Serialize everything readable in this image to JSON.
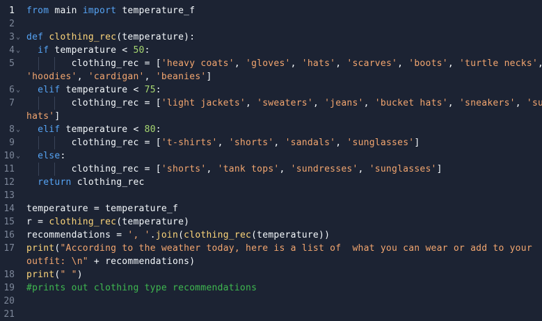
{
  "editor": {
    "lines": [
      {
        "n": "1",
        "active": true,
        "fold": false,
        "tokens": [
          [
            "kw",
            "from"
          ],
          [
            "op",
            " main "
          ],
          [
            "kw",
            "import"
          ],
          [
            "op",
            " temperature_f"
          ]
        ]
      },
      {
        "n": "2",
        "fold": false,
        "tokens": []
      },
      {
        "n": "3",
        "fold": true,
        "tokens": [
          [
            "kw",
            "def"
          ],
          [
            "op",
            " "
          ],
          [
            "fn",
            "clothing_rec"
          ],
          [
            "op",
            "(temperature):"
          ]
        ]
      },
      {
        "n": "4",
        "fold": true,
        "tokens": [
          [
            "op",
            "  "
          ],
          [
            "kw",
            "if"
          ],
          [
            "op",
            " temperature < "
          ],
          [
            "num",
            "50"
          ],
          [
            "op",
            ":"
          ]
        ]
      },
      {
        "n": "5",
        "fold": false,
        "guides": [
          2
        ],
        "tokens": [
          [
            "op",
            "        clothing_rec = ["
          ],
          [
            "str",
            "'heavy coats'"
          ],
          [
            "op",
            ", "
          ],
          [
            "str",
            "'gloves'"
          ],
          [
            "op",
            ", "
          ],
          [
            "str",
            "'hats'"
          ],
          [
            "op",
            ", "
          ],
          [
            "str",
            "'scarves'"
          ],
          [
            "op",
            ", "
          ],
          [
            "str",
            "'boots'"
          ],
          [
            "op",
            ", "
          ],
          [
            "str",
            "'turtle necks'"
          ],
          [
            "op",
            ","
          ]
        ]
      },
      {
        "n": "",
        "fold": false,
        "tokens": [
          [
            "str",
            "'hoodies'"
          ],
          [
            "op",
            ", "
          ],
          [
            "str",
            "'cardigan'"
          ],
          [
            "op",
            ", "
          ],
          [
            "str",
            "'beanies'"
          ],
          [
            "op",
            "]"
          ]
        ]
      },
      {
        "n": "6",
        "fold": true,
        "tokens": [
          [
            "op",
            "  "
          ],
          [
            "kw",
            "elif"
          ],
          [
            "op",
            " temperature < "
          ],
          [
            "num",
            "75"
          ],
          [
            "op",
            ":"
          ]
        ]
      },
      {
        "n": "7",
        "fold": false,
        "guides": [
          2
        ],
        "tokens": [
          [
            "op",
            "        clothing_rec = ["
          ],
          [
            "str",
            "'light jackets'"
          ],
          [
            "op",
            ", "
          ],
          [
            "str",
            "'sweaters'"
          ],
          [
            "op",
            ", "
          ],
          [
            "str",
            "'jeans'"
          ],
          [
            "op",
            ", "
          ],
          [
            "str",
            "'bucket hats'"
          ],
          [
            "op",
            ", "
          ],
          [
            "str",
            "'sneakers'"
          ],
          [
            "op",
            ", "
          ],
          [
            "str",
            "'sun"
          ]
        ]
      },
      {
        "n": "",
        "fold": false,
        "tokens": [
          [
            "str",
            "hats'"
          ],
          [
            "op",
            "]"
          ]
        ]
      },
      {
        "n": "8",
        "fold": true,
        "tokens": [
          [
            "op",
            "  "
          ],
          [
            "kw",
            "elif"
          ],
          [
            "op",
            " temperature < "
          ],
          [
            "num",
            "80"
          ],
          [
            "op",
            ":"
          ]
        ]
      },
      {
        "n": "9",
        "fold": false,
        "guides": [
          2
        ],
        "tokens": [
          [
            "op",
            "        clothing_rec = ["
          ],
          [
            "str",
            "'t-shirts'"
          ],
          [
            "op",
            ", "
          ],
          [
            "str",
            "'shorts'"
          ],
          [
            "op",
            ", "
          ],
          [
            "str",
            "'sandals'"
          ],
          [
            "op",
            ", "
          ],
          [
            "str",
            "'sunglasses'"
          ],
          [
            "op",
            "]"
          ]
        ]
      },
      {
        "n": "10",
        "fold": true,
        "tokens": [
          [
            "op",
            "  "
          ],
          [
            "kw",
            "else"
          ],
          [
            "op",
            ":"
          ]
        ]
      },
      {
        "n": "11",
        "fold": false,
        "guides": [
          2
        ],
        "tokens": [
          [
            "op",
            "        clothing_rec = ["
          ],
          [
            "str",
            "'shorts'"
          ],
          [
            "op",
            ", "
          ],
          [
            "str",
            "'tank tops'"
          ],
          [
            "op",
            ", "
          ],
          [
            "str",
            "'sundresses'"
          ],
          [
            "op",
            ", "
          ],
          [
            "str",
            "'sunglasses'"
          ],
          [
            "op",
            "]"
          ]
        ]
      },
      {
        "n": "12",
        "fold": false,
        "tokens": [
          [
            "op",
            "  "
          ],
          [
            "kw",
            "return"
          ],
          [
            "op",
            " clothing_rec"
          ]
        ]
      },
      {
        "n": "13",
        "fold": false,
        "tokens": []
      },
      {
        "n": "14",
        "fold": false,
        "tokens": [
          [
            "op",
            "temperature = temperature_f"
          ]
        ]
      },
      {
        "n": "15",
        "fold": false,
        "tokens": [
          [
            "op",
            "r = "
          ],
          [
            "fn",
            "clothing_rec"
          ],
          [
            "op",
            "(temperature)"
          ]
        ]
      },
      {
        "n": "16",
        "fold": false,
        "tokens": [
          [
            "op",
            "recommendations = "
          ],
          [
            "str",
            "', '"
          ],
          [
            "op",
            "."
          ],
          [
            "fn",
            "join"
          ],
          [
            "op",
            "("
          ],
          [
            "fn",
            "clothing_rec"
          ],
          [
            "op",
            "(temperature))"
          ]
        ]
      },
      {
        "n": "17",
        "fold": false,
        "tokens": [
          [
            "bi",
            "print"
          ],
          [
            "op",
            "("
          ],
          [
            "str",
            "\"According to the weather today, here is a list of  what you can wear or add to your"
          ]
        ]
      },
      {
        "n": "",
        "fold": false,
        "tokens": [
          [
            "str",
            "outfit: \\n\""
          ],
          [
            "op",
            " + recommendations)"
          ]
        ]
      },
      {
        "n": "18",
        "fold": false,
        "tokens": [
          [
            "bi",
            "print"
          ],
          [
            "op",
            "("
          ],
          [
            "str",
            "\" \""
          ],
          [
            "op",
            ")"
          ]
        ]
      },
      {
        "n": "19",
        "fold": false,
        "tokens": [
          [
            "cm",
            "#prints out clothing type recommendations"
          ]
        ]
      },
      {
        "n": "20",
        "fold": false,
        "tokens": []
      },
      {
        "n": "21",
        "fold": false,
        "tokens": []
      }
    ]
  },
  "colors": {
    "background": "#1c2333",
    "keyword": "#56a4f5",
    "function": "#fcd57a",
    "number": "#a8d971",
    "string": "#f3a66f",
    "comment": "#3fb950",
    "text": "#f5f9fc",
    "gutter": "#7d8799"
  },
  "icons": {
    "fold": "chevron-down-icon"
  }
}
